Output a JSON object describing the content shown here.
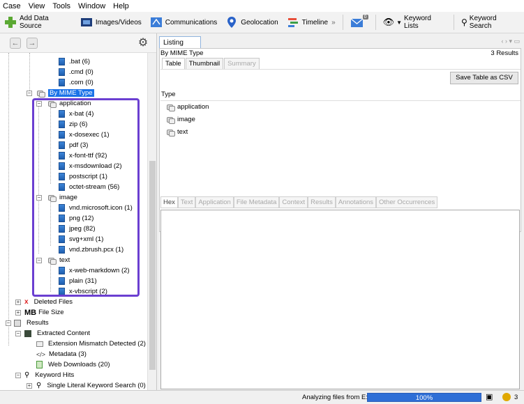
{
  "menu": [
    "Case",
    "View",
    "Tools",
    "Window",
    "Help"
  ],
  "toolbar": {
    "add_data_source": "Add Data Source",
    "images_videos": "Images/Videos",
    "communications": "Communications",
    "geolocation": "Geolocation",
    "timeline": "Timeline",
    "mail_badge": "0",
    "keyword_lists": "Keyword Lists",
    "keyword_search": "Keyword Search"
  },
  "tree": {
    "top_items": [
      ".bat (6)",
      ".cmd (0)",
      ".com (0)"
    ],
    "by_mime_type": "By MIME Type",
    "application": {
      "label": "application",
      "items": [
        "x-bat (4)",
        "zip (6)",
        "x-dosexec (1)",
        "pdf (3)",
        "x-font-ttf (92)",
        "x-msdownload (2)",
        "postscript (1)",
        "octet-stream (56)"
      ]
    },
    "image": {
      "label": "image",
      "items": [
        "vnd.microsoft.icon (1)",
        "png (12)",
        "jpeg (82)",
        "svg+xml (1)",
        "vnd.zbrush.pcx (1)"
      ]
    },
    "text": {
      "label": "text",
      "items": [
        "x-web-markdown (2)",
        "plain (31)",
        "x-vbscript (2)"
      ]
    },
    "deleted_files": "Deleted Files",
    "file_size": "File Size",
    "mb": "MB",
    "results": "Results",
    "extracted_content": "Extracted Content",
    "extension_mismatch": "Extension Mismatch Detected (2)",
    "metadata": "Metadata (3)",
    "web_downloads": "Web Downloads (20)",
    "keyword_hits": "Keyword Hits",
    "single_literal": "Single Literal Keyword Search (0)"
  },
  "listing": {
    "tab": "Listing",
    "title": "By MIME Type",
    "results": "3  Results",
    "subtabs": [
      "Table",
      "Thumbnail",
      "Summary"
    ],
    "save_button": "Save Table as CSV",
    "column": "Type",
    "rows": [
      "application",
      "image",
      "text"
    ]
  },
  "viewer_tabs": [
    "Hex",
    "Text",
    "Application",
    "File Metadata",
    "Context",
    "Results",
    "Annotations",
    "Other Occurrences"
  ],
  "status": {
    "analyzing": "Analyzing files from E:",
    "progress": "100%",
    "progress_value": 100,
    "notification_count": "3"
  },
  "colors": {
    "highlight": "#1a73e8",
    "annotation_box": "#6b3fd1",
    "progress": "#2f6fd6"
  }
}
